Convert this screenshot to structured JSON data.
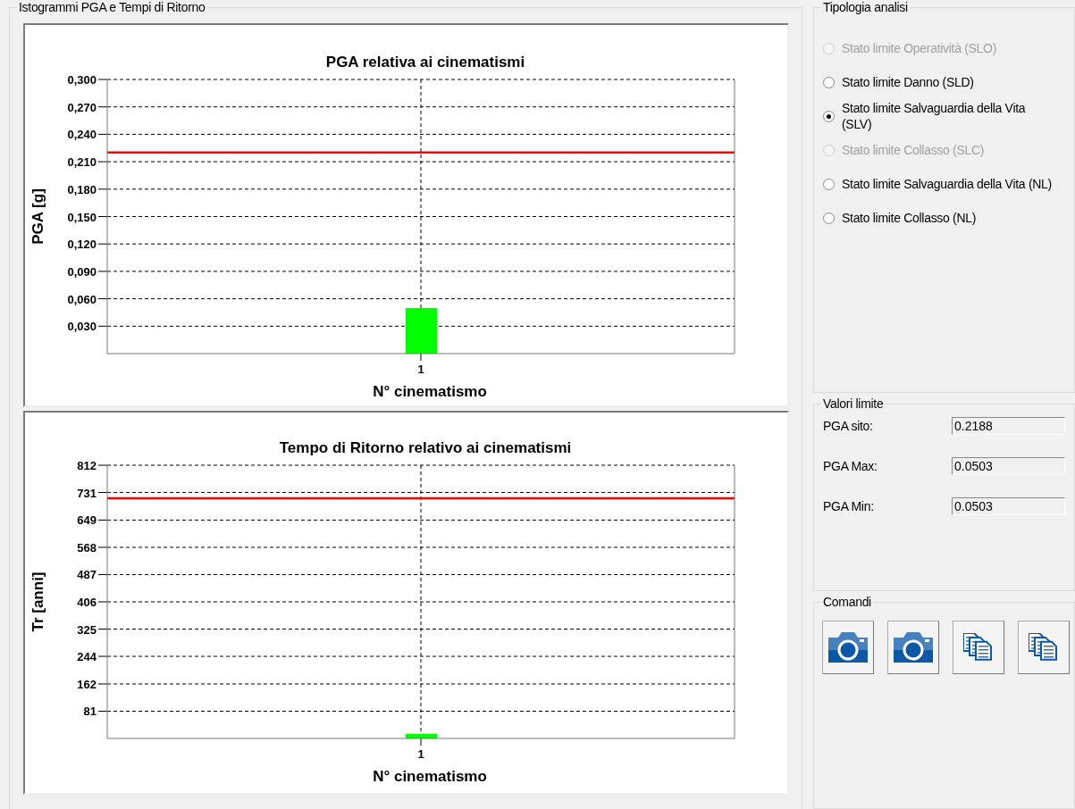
{
  "chart_group": {
    "title": "Istogrammi PGA e Tempi di Ritorno",
    "charts": [
      {
        "chart_data": {
          "type": "bar",
          "title": "PGA relativa ai cinematismi",
          "xlabel": "N° cinematismo",
          "ylabel": "PGA [g]",
          "categories": [
            "1"
          ],
          "series": [
            {
              "color": "#00ff00",
              "values": [
                0.05
              ]
            }
          ],
          "grid": true,
          "ylim": [
            0,
            0.3
          ],
          "yticks": [
            {
              "value": 0.03,
              "label": "0,030"
            },
            {
              "value": 0.06,
              "label": "0,060"
            },
            {
              "value": 0.09,
              "label": "0,090"
            },
            {
              "value": 0.12,
              "label": "0,120"
            },
            {
              "value": 0.15,
              "label": "0,150"
            },
            {
              "value": 0.18,
              "label": "0,180"
            },
            {
              "value": 0.21,
              "label": "0,210"
            },
            {
              "value": 0.24,
              "label": "0,240"
            },
            {
              "value": 0.27,
              "label": "0,270"
            },
            {
              "value": 0.3,
              "label": "0,300"
            }
          ],
          "ref_lines": [
            {
              "axis": "y",
              "value": 0.22,
              "color": "#ff0000"
            }
          ]
        }
      },
      {
        "chart_data": {
          "type": "bar",
          "title": "Tempo di Ritorno relativo ai cinematismi",
          "xlabel": "N° cinematismo",
          "ylabel": "Tr [anni]",
          "categories": [
            "1"
          ],
          "series": [
            {
              "color": "#00ff00",
              "values": [
                14
              ]
            }
          ],
          "grid": true,
          "ylim": [
            0,
            812
          ],
          "yticks": [
            81,
            162,
            244,
            325,
            406,
            487,
            568,
            649,
            731,
            812
          ],
          "ref_lines": [
            {
              "axis": "y",
              "value": 714,
              "color": "#ff0000"
            }
          ]
        }
      }
    ]
  },
  "analysis_type": {
    "title": "Tipologia analisi",
    "options": [
      {
        "label": "Stato limite Operatività (SLO)",
        "selected": false,
        "disabled": true
      },
      {
        "label": "Stato limite Danno (SLD)",
        "selected": false,
        "disabled": false
      },
      {
        "label": "Stato limite Salvaguardia della Vita (SLV)",
        "selected": true,
        "disabled": false
      },
      {
        "label": "Stato limite Collasso (SLC)",
        "selected": false,
        "disabled": true
      },
      {
        "label": "Stato limite Salvaguardia della Vita (NL)",
        "selected": false,
        "disabled": false
      },
      {
        "label": "Stato limite Collasso (NL)",
        "selected": false,
        "disabled": false
      }
    ]
  },
  "limit_values": {
    "title": "Valori limite",
    "fields": [
      {
        "label": "PGA sito:",
        "value": "0.2188"
      },
      {
        "label": "PGA Max:",
        "value": "0.0503"
      },
      {
        "label": "PGA Min:",
        "value": "0.0503"
      }
    ]
  },
  "commands": {
    "title": "Comandi",
    "buttons": [
      {
        "kind": "camera"
      },
      {
        "kind": "camera"
      },
      {
        "kind": "copy"
      },
      {
        "kind": "copy"
      }
    ]
  }
}
